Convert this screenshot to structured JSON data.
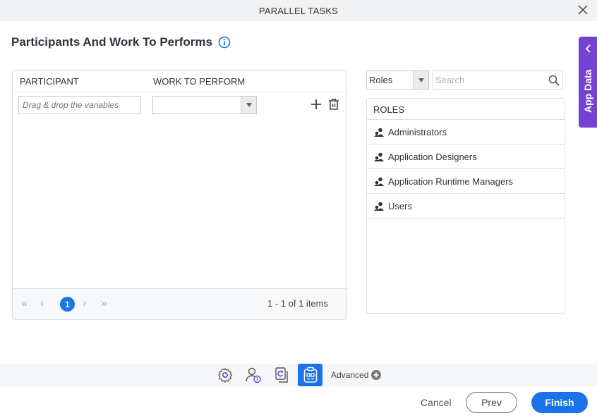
{
  "window": {
    "title": "PARALLEL TASKS",
    "close_icon": "close-icon"
  },
  "page": {
    "title": "Participants And Work To Performs",
    "info_icon": "info-icon"
  },
  "grid": {
    "columns": [
      "PARTICIPANT",
      "WORK TO PERFORM"
    ],
    "rows": [
      {
        "participant_placeholder": "Drag & drop the variables",
        "work_to_perform": ""
      }
    ],
    "pager": {
      "current_page": "1",
      "info": "1 - 1 of 1 items"
    }
  },
  "roles_panel": {
    "filter_value": "Roles",
    "search_placeholder": "Search",
    "header": "ROLES",
    "items": [
      "Administrators",
      "Application Designers",
      "Application Runtime Managers",
      "Users"
    ]
  },
  "app_data": {
    "label": "App Data"
  },
  "toolbar": {
    "advanced_label": "Advanced"
  },
  "footer": {
    "cancel": "Cancel",
    "prev": "Prev",
    "finish": "Finish"
  },
  "colors": {
    "accent": "#1a73e8",
    "app_data": "#7542d4"
  }
}
